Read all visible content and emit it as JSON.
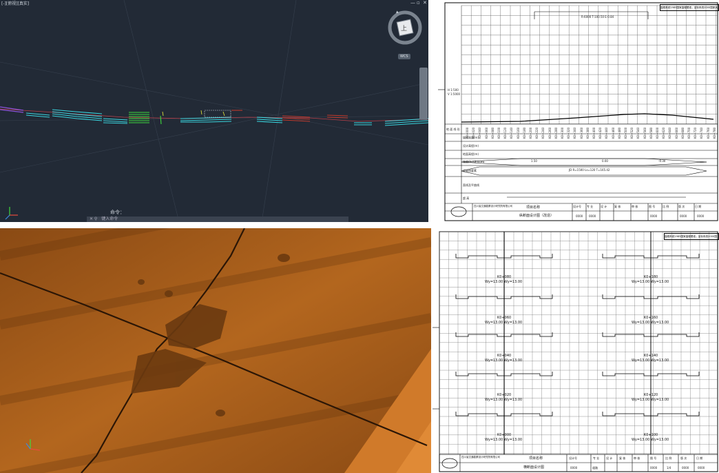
{
  "cad": {
    "title": "[-][俯视][真实]",
    "command_history": "命令：",
    "command_prompt": "键入命令",
    "viewcube_face": "上",
    "wcs_label": "WCS",
    "win_controls": [
      "—",
      "▫",
      "✕"
    ]
  },
  "profile_sheet": {
    "corner_note": "高程系统1985国家高程基准；坐标系统2000国家大地坐标系",
    "peak_annotation": "R-6000  T-100.50  E-0.84",
    "scale_labels": [
      "H 1:500",
      "V 1:5000"
    ],
    "row_labels": [
      "地 面 线 形",
      "填挖高度(m)",
      "设计高程(m)",
      "地面高程(m)",
      "坡度(%)/坡长(m)",
      "竖曲线要素",
      "直线及平曲线",
      "超 高"
    ],
    "grade_left": "1.50",
    "grade_mid": "0.00",
    "grade_right": "-0.30",
    "curve_text": "JD  R=1500  Ls=120  T=165.42",
    "stations": [
      "K0+000",
      "K0+020",
      "K0+040",
      "K0+060",
      "K0+080",
      "K0+100",
      "K0+120",
      "K0+140",
      "K0+160",
      "K0+180",
      "K0+200",
      "K0+220",
      "K0+240",
      "K0+260",
      "K0+280",
      "K0+300",
      "K0+320",
      "K0+340",
      "K0+360",
      "K0+380",
      "K0+400",
      "K0+420",
      "K0+440",
      "K0+460",
      "K0+480",
      "K0+500",
      "K0+520",
      "K0+540",
      "K0+560",
      "K0+580",
      "K0+600",
      "K0+620",
      "K0+640",
      "K0+660",
      "K0+680",
      "K0+700",
      "K0+720",
      "K0+740",
      "K0+760",
      "K0+780"
    ],
    "title_block": {
      "company": "四川省交通勘察设计研究院有限公司",
      "project_label": "项目名称",
      "drawing_name": "纵断面设计图（改造）",
      "labels": [
        "设计号",
        "专 业",
        "设 计",
        "复 核",
        "审 核",
        "图 号",
        "比 例",
        "版 次",
        "日 期"
      ],
      "values": [
        "0000",
        "0000",
        "0000",
        "0000",
        "0000"
      ]
    }
  },
  "section_sheet": {
    "corner_note": "高程系统1985国家高程基准；坐标系统2000国家大地坐标系",
    "sections": [
      {
        "station": "K0+080",
        "values": "Wy=13.00  Wy=13.00"
      },
      {
        "station": "K0+060",
        "values": "Wy=13.00  Wy=13.00"
      },
      {
        "station": "K0+040",
        "values": "Wy=13.00  Wy=13.00"
      },
      {
        "station": "K0+020",
        "values": "Wy=13.00  Wy=13.00"
      },
      {
        "station": "K0+000",
        "values": "Wy=13.00  Wy=13.00"
      },
      {
        "station": "K0+180",
        "values": "Wy=13.00  Wy=13.00"
      },
      {
        "station": "K0+160",
        "values": "Wy=13.00  Wy=13.00"
      },
      {
        "station": "K0+140",
        "values": "Wy=13.00  Wy=13.00"
      },
      {
        "station": "K0+120",
        "values": "Wy=13.00  Wy=13.00"
      },
      {
        "station": "K0+100",
        "values": "Wy=13.00  Wy=13.00"
      }
    ],
    "title_block": {
      "company": "四川省交通勘察设计研究院有限公司",
      "project_label": "项目名称",
      "drawing_name": "横断面设计图",
      "labels": [
        "设计号",
        "专 业",
        "设 计",
        "复 核",
        "审 核",
        "图 号",
        "比 例",
        "版 次",
        "日 期"
      ],
      "values": [
        "0000",
        "道路",
        "0000",
        "1/4",
        "0000",
        "0000"
      ]
    }
  },
  "colors": {
    "cad_bg": "#222a36",
    "cloud_orange": "#a95e1a",
    "cyan": "#39d6e0",
    "green": "#3ddc3d",
    "red": "#c0392b"
  }
}
